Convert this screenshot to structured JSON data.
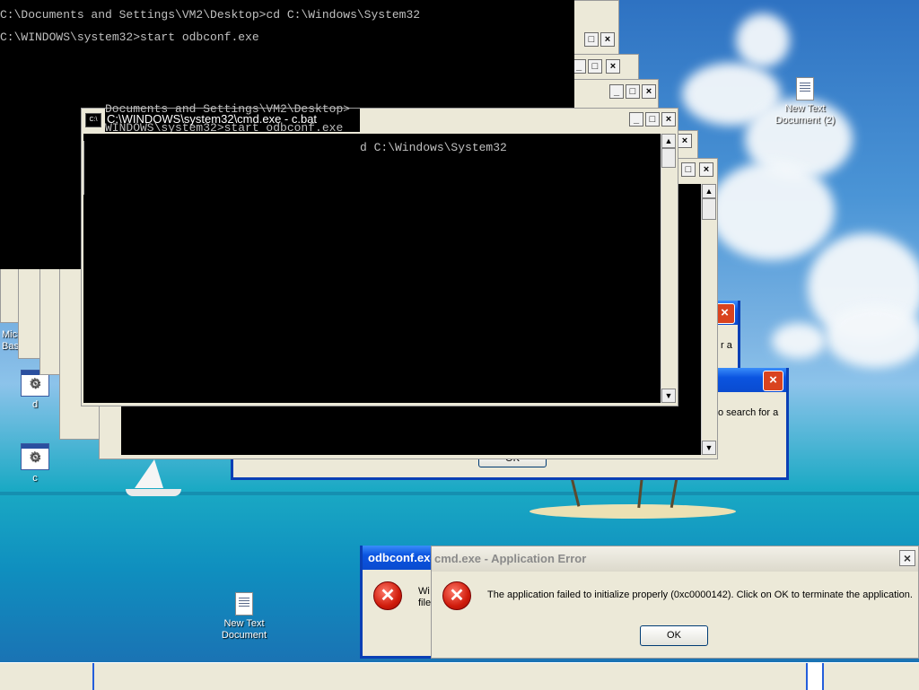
{
  "desktop": {
    "icons": [
      {
        "label_line1": "New Text",
        "label_line2": "Document (2)",
        "icon": "text-document-icon"
      },
      {
        "label_line1": "Microsoft",
        "label_line2": "Basic",
        "icon": "application-icon"
      },
      {
        "label_line1": "d",
        "label_line2": "",
        "icon": "batch-file-icon"
      },
      {
        "label_line1": "c",
        "label_line2": "",
        "icon": "batch-file-icon"
      },
      {
        "label_line1": "New Text",
        "label_line2": "Document",
        "icon": "text-document-icon"
      }
    ]
  },
  "console_top": {
    "line1": "C:\\Documents and Settings\\VM2\\Desktop>cd C:\\Windows\\System32",
    "line2": "C:\\WINDOWS\\system32>start odbconf.exe"
  },
  "cmd_window": {
    "title": "C:\\WINDOWS\\system32\\cmd.exe - c.bat",
    "ghost_line_a": "Documents and Settings\\VM2\\Desktop>",
    "ghost_line_b": "WINDOWS\\system32>start odbconf.exe",
    "body_fragment": "d C:\\Windows\\System32",
    "minimize": "_",
    "maximize": "□",
    "close": "×"
  },
  "back_dialog": {
    "text_fragment_1": "r a",
    "text_fragment_2": "o search for a",
    "ok_label": "OK",
    "close": "×"
  },
  "odbconf_dialog": {
    "title": "odbconf.exe",
    "text_fragment_1": "Wi",
    "text_fragment_2": "file"
  },
  "error_dialog": {
    "title": "cmd.exe - Application Error",
    "message": "The application failed to initialize properly (0xc0000142). Click on OK to terminate the application.",
    "ok_label": "OK",
    "close": "×",
    "icon": "error-icon"
  },
  "colors": {
    "xp_title_blue": "#0a4bd0",
    "dialog_face": "#ece9d8",
    "console_bg": "#000000",
    "console_text": "#c0c0c0",
    "error_red": "#d01c0c"
  }
}
